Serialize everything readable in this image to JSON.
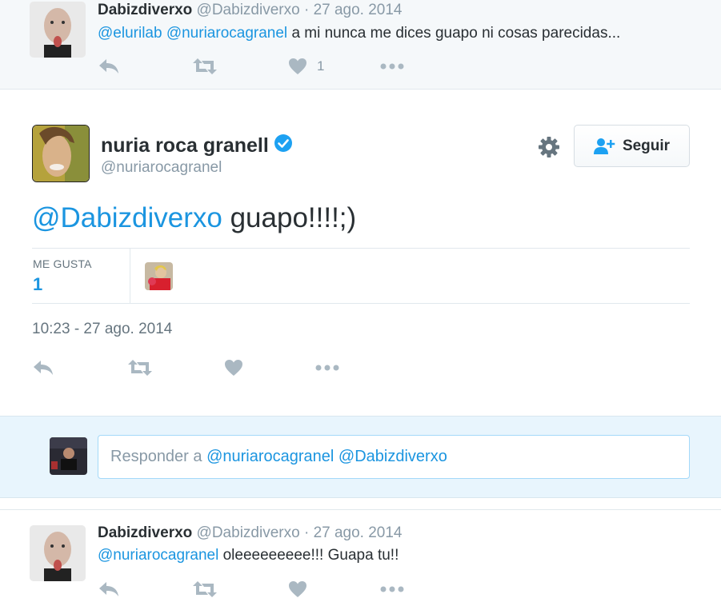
{
  "top_tweet": {
    "name": "Dabizdiverxo",
    "handle": "@Dabizdiverxo",
    "date": "27 ago. 2014",
    "separator": "·",
    "mention1": "@elurilab",
    "mention2": "@nuriarocagranel",
    "text": "a mi nunca me dices guapo ni cosas parecidas...",
    "like_count": "1"
  },
  "main_tweet": {
    "name": "nuria roca granell",
    "handle": "@nuriarocagranel",
    "follow_label": "Seguir",
    "mention": "@Dabizdiverxo",
    "text": "guapo!!!!;)",
    "likes_label": "ME GUSTA",
    "likes_value": "1",
    "timestamp": "10:23 - 27 ago. 2014"
  },
  "reply": {
    "prefix": "Responder a",
    "mentions": "@nuriarocagranel @Dabizdiverxo"
  },
  "bottom_tweet": {
    "name": "Dabizdiverxo",
    "handle": "@Dabizdiverxo",
    "date": "27 ago. 2014",
    "separator": "·",
    "mention": "@nuriarocagranel",
    "text": "oleeeeeeeee!!! Guapa tu!!"
  },
  "colors": {
    "link_blue": "#1b95e0",
    "icon_grey": "#aab8c2",
    "reply_bg": "#e8f5fd",
    "context_bg": "#f5f8fa"
  },
  "icons": [
    "reply-icon",
    "retweet-icon",
    "heart-icon",
    "more-icon",
    "gear-icon",
    "follow-user-icon",
    "verified-badge-icon"
  ]
}
